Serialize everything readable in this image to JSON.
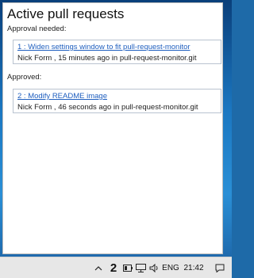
{
  "popup": {
    "title": "Active pull requests",
    "approval_needed_label": "Approval needed:",
    "approved_label": "Approved:",
    "approval_needed": [
      {
        "link": "1 : Widen settings window to fit pull-request-monitor",
        "meta": "Nick Form , 15 minutes ago in pull-request-monitor.git"
      }
    ],
    "approved": [
      {
        "link": "2 : Modify README image",
        "meta": "Nick Form , 46 seconds ago in pull-request-monitor.git"
      }
    ]
  },
  "taskbar": {
    "badge_count": "2",
    "language": "ENG",
    "time": "21:42",
    "icons": [
      "chevron-up-icon",
      "pull-request-count-icon",
      "battery-icon",
      "network-icon",
      "volume-icon",
      "notifications-icon"
    ]
  }
}
